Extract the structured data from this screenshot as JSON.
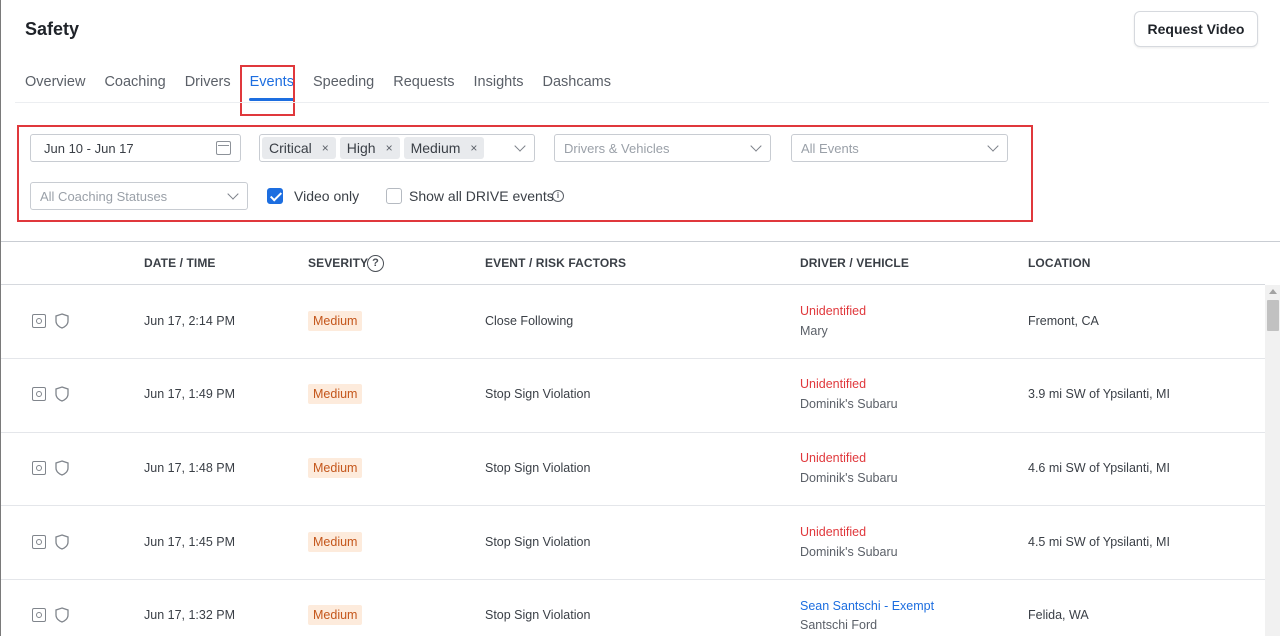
{
  "page": {
    "title": "Safety",
    "request_video_label": "Request Video"
  },
  "tabs": [
    {
      "label": "Overview",
      "active": false
    },
    {
      "label": "Coaching",
      "active": false
    },
    {
      "label": "Drivers",
      "active": false
    },
    {
      "label": "Events",
      "active": true
    },
    {
      "label": "Speeding",
      "active": false
    },
    {
      "label": "Requests",
      "active": false
    },
    {
      "label": "Insights",
      "active": false
    },
    {
      "label": "Dashcams",
      "active": false
    }
  ],
  "filters": {
    "date_range": "Jun 10 - Jun 17",
    "severity_chips": [
      "Critical",
      "High",
      "Medium"
    ],
    "chip_remove_symbol": "×",
    "drivers_vehicles_placeholder": "Drivers & Vehicles",
    "events_placeholder": "All Events",
    "coaching_status_placeholder": "All Coaching Statuses",
    "video_only_label": "Video only",
    "video_only_checked": true,
    "show_drive_label": "Show all DRIVE events",
    "show_drive_checked": false,
    "info_symbol": "i"
  },
  "table": {
    "columns": {
      "date_time": "DATE / TIME",
      "severity": "SEVERITY",
      "severity_help": "?",
      "event": "EVENT / RISK FACTORS",
      "driver_vehicle": "DRIVER / VEHICLE",
      "location": "LOCATION"
    },
    "rows": [
      {
        "date_time": "Jun 17, 2:14 PM",
        "severity": "Medium",
        "event": "Close Following",
        "driver": "Unidentified",
        "driver_color": "#e0383c",
        "vehicle": "Mary",
        "location": "Fremont, CA"
      },
      {
        "date_time": "Jun 17, 1:49 PM",
        "severity": "Medium",
        "event": "Stop Sign Violation",
        "driver": "Unidentified",
        "driver_color": "#e0383c",
        "vehicle": "Dominik's Subaru",
        "location": "3.9 mi SW of Ypsilanti, MI"
      },
      {
        "date_time": "Jun 17, 1:48 PM",
        "severity": "Medium",
        "event": "Stop Sign Violation",
        "driver": "Unidentified",
        "driver_color": "#e0383c",
        "vehicle": "Dominik's Subaru",
        "location": "4.6 mi SW of Ypsilanti, MI"
      },
      {
        "date_time": "Jun 17, 1:45 PM",
        "severity": "Medium",
        "event": "Stop Sign Violation",
        "driver": "Unidentified",
        "driver_color": "#e0383c",
        "vehicle": "Dominik's Subaru",
        "location": "4.5 mi SW of Ypsilanti, MI"
      },
      {
        "date_time": "Jun 17, 1:32 PM",
        "severity": "Medium",
        "event": "Stop Sign Violation",
        "driver": "Sean Santschi - Exempt",
        "driver_color": "#1d6ee0",
        "vehicle": "Santschi Ford",
        "location": "Felida, WA"
      }
    ]
  },
  "icons": {
    "calendar": "calendar-icon",
    "chevron": "chevron-down-icon",
    "camera": "camera-icon",
    "shield": "shield-icon",
    "info": "info-icon",
    "help": "help-icon"
  },
  "colors": {
    "accent": "#1d6ee0",
    "highlight_box": "#e0383c",
    "severity_medium_bg": "#fdebdc",
    "severity_medium_text": "#c4561b"
  }
}
